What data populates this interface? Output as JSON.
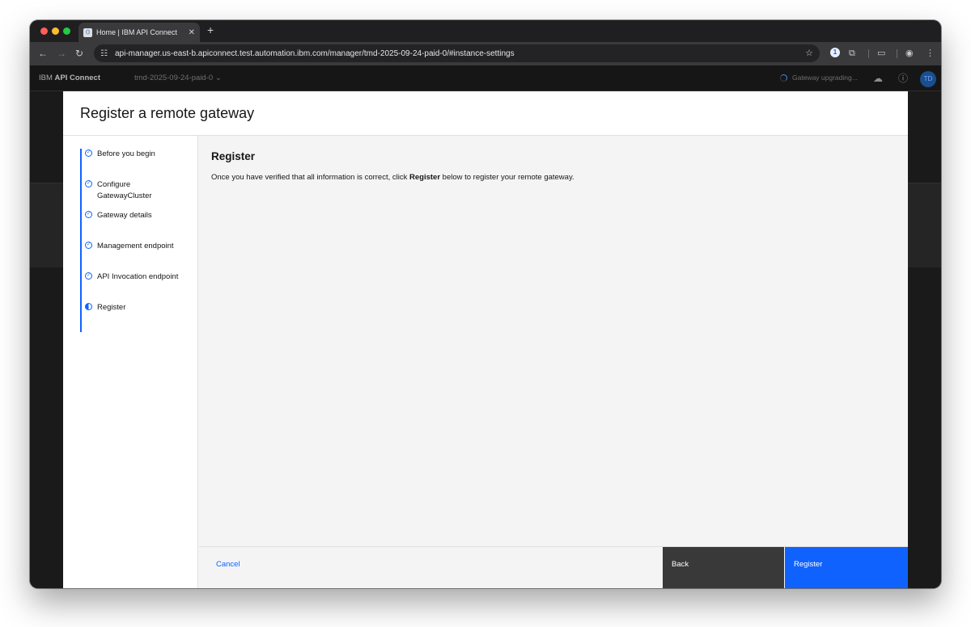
{
  "browser": {
    "tab_title": "Home | IBM API Connect",
    "favicon": "api-connect-icon",
    "url": "api-manager.us-east-b.apiconnect.test.automation.ibm.com/manager/tmd-2025-09-24-paid-0/#instance-settings"
  },
  "app": {
    "brand_prefix": "IBM ",
    "brand_name": "API Connect",
    "instance": "tmd-2025-09-24-paid-0",
    "status": "Gateway upgrading...",
    "avatar_initials": "TD"
  },
  "modal": {
    "title": "Register a remote gateway",
    "steps": [
      {
        "label": "Before you begin",
        "state": "complete"
      },
      {
        "label": "Configure GatewayCluster",
        "state": "complete"
      },
      {
        "label": "Gateway details",
        "state": "complete"
      },
      {
        "label": "Management endpoint",
        "state": "complete"
      },
      {
        "label": "API Invocation endpoint",
        "state": "complete"
      },
      {
        "label": "Register",
        "state": "current"
      }
    ],
    "heading": "Register",
    "text_before": "Once you have verified that all information is correct, click ",
    "text_bold": "Register",
    "text_after": " below to register your remote gateway.",
    "cancel_label": "Cancel",
    "back_label": "Back",
    "register_label": "Register"
  },
  "colors": {
    "primary": "#0f62fe",
    "secondary_button": "#393939",
    "header_bg": "#161616"
  }
}
